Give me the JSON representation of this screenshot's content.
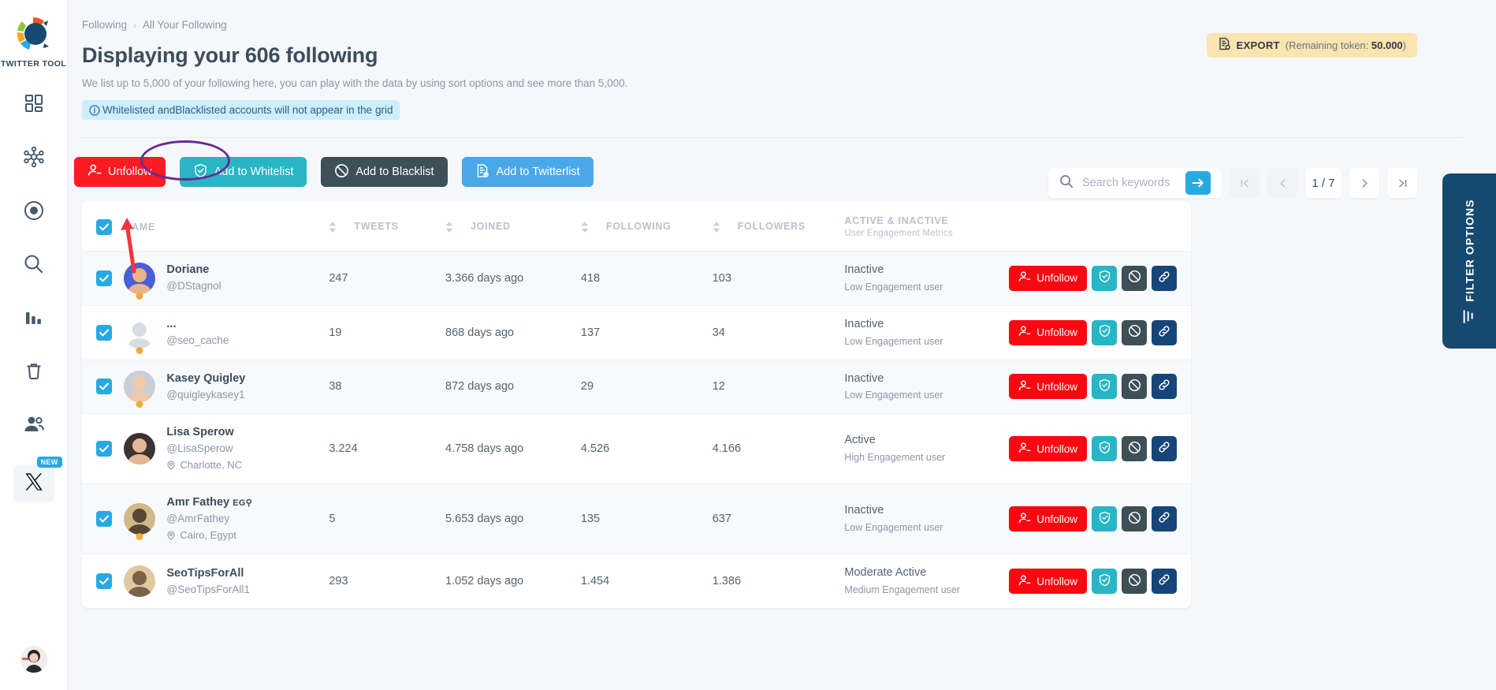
{
  "sidebar": {
    "brand_name": "TWITTER TOOL",
    "items": [
      {
        "icon": "dashboard-grid-icon",
        "name": "dashboard"
      },
      {
        "icon": "network-nodes-icon",
        "name": "network"
      },
      {
        "icon": "target-circle-icon",
        "name": "target"
      },
      {
        "icon": "search-icon",
        "name": "search"
      },
      {
        "icon": "bar-chart-icon",
        "name": "analytics"
      },
      {
        "icon": "trash-icon",
        "name": "cleanup"
      },
      {
        "icon": "people-icon",
        "name": "audience"
      },
      {
        "icon": "x-logo-icon",
        "name": "x-platform",
        "badge": "NEW"
      }
    ]
  },
  "breadcrumb": {
    "parent": "Following",
    "separator": "›",
    "current": "All Your Following"
  },
  "header": {
    "title": "Displaying your 606 following",
    "subtitle": "We list up to 5,000 of your following here, you can play with the data by using sort options and see more than 5,000.",
    "notice": "Whitelisted andBlacklisted accounts will not appear in the grid"
  },
  "export": {
    "label": "EXPORT",
    "token_prefix": "(Remaining token: ",
    "token_value": "50.000",
    "token_suffix": ")"
  },
  "toolbar": {
    "unfollow": "Unfollow",
    "add_whitelist": "Add to Whitelist",
    "add_blacklist": "Add to Blacklist",
    "add_twitterlist": "Add to Twitterlist"
  },
  "search": {
    "placeholder": "Search keywords",
    "value": ""
  },
  "pagination": {
    "first": "|‹",
    "prev": "‹",
    "current": "1 / 7",
    "next": "›",
    "last": "›|"
  },
  "filter_panel": {
    "label": "FILTER OPTIONS"
  },
  "table": {
    "columns": {
      "name": "NAME",
      "tweets": "TWEETS",
      "joined": "JOINED",
      "following": "FOLLOWING",
      "followers": "FOLLOWERS",
      "status": "ACTIVE & INACTIVE",
      "status_sub": "User Engagement Metrics"
    },
    "row_action_labels": {
      "unfollow": "Unfollow"
    },
    "rows": [
      {
        "checked": true,
        "name": "Doriane",
        "flag": "",
        "handle": "@DStagnol",
        "location": "",
        "tweets": "247",
        "joined": "3.366 days ago",
        "following": "418",
        "followers": "103",
        "status": "Inactive",
        "engagement": "Low Engagement user",
        "dot": true,
        "avatar_colors": [
          "#4a5fd6",
          "#e8b48c"
        ]
      },
      {
        "checked": true,
        "name": "...",
        "flag": "",
        "handle": "@seo_cache",
        "location": "",
        "tweets": "19",
        "joined": "868 days ago",
        "following": "137",
        "followers": "34",
        "status": "Inactive",
        "engagement": "Low Engagement user",
        "dot": true,
        "avatar_colors": [
          "#ffffff",
          "#d8dde4"
        ]
      },
      {
        "checked": true,
        "name": "Kasey Quigley",
        "flag": "",
        "handle": "@quigleykasey1",
        "location": "",
        "tweets": "38",
        "joined": "872 days ago",
        "following": "29",
        "followers": "12",
        "status": "Inactive",
        "engagement": "Low Engagement user",
        "dot": true,
        "avatar_colors": [
          "#c9cfd8",
          "#f0c9a8"
        ]
      },
      {
        "checked": true,
        "name": "Lisa Sperow",
        "flag": "",
        "handle": "@LisaSperow",
        "location": "Charlotte, NC",
        "tweets": "3.224",
        "joined": "4.758 days ago",
        "following": "4.526",
        "followers": "4.166",
        "status": "Active",
        "engagement": "High Engagement user",
        "dot": false,
        "avatar_colors": [
          "#3b3330",
          "#e3b894"
        ]
      },
      {
        "checked": true,
        "name": "Amr Fathey",
        "flag": "EG⚲",
        "handle": "@AmrFathey",
        "location": "Cairo, Egypt",
        "tweets": "5",
        "joined": "5.653 days ago",
        "following": "135",
        "followers": "637",
        "status": "Inactive",
        "engagement": "Low Engagement user",
        "dot": true,
        "avatar_colors": [
          "#d2b98a",
          "#5a4634"
        ]
      },
      {
        "checked": true,
        "name": "SeoTipsForAll",
        "flag": "",
        "handle": "@SeoTipsForAll1",
        "location": "",
        "tweets": "293",
        "joined": "1.052 days ago",
        "following": "1.454",
        "followers": "1.386",
        "status": "Moderate Active",
        "engagement": "Medium Engagement user",
        "dot": false,
        "avatar_colors": [
          "#e0c9a0",
          "#7a6248"
        ]
      }
    ]
  },
  "colors": {
    "accent_blue": "#29a9e1",
    "danger_red": "#fb1b23",
    "teal": "#28b5c4",
    "dark_slate": "#3d4f57",
    "twitter_blue": "#4aa7e8",
    "navy": "#16496f",
    "export_yellow": "#fae4af",
    "notice_blue": "#cdeefb",
    "annotation_purple": "#6b2a93",
    "annotation_red": "#f4333d"
  }
}
